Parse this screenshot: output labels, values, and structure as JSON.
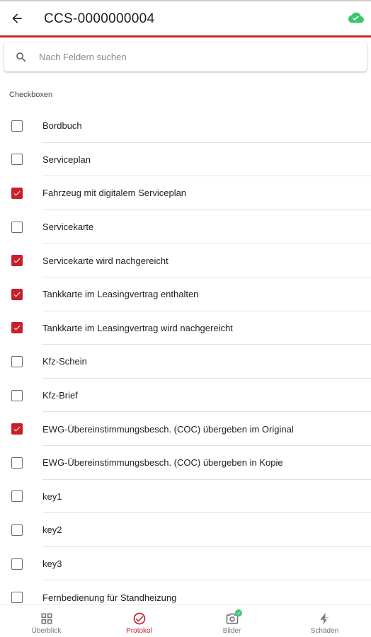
{
  "header": {
    "title": "CCS-0000000004",
    "back_icon": "arrow-left-icon",
    "sync_icon": "cloud-check-icon",
    "sync_color": "#3cc66a"
  },
  "accent_color": "#d2232a",
  "search": {
    "placeholder": "Nach Feldern suchen",
    "value": ""
  },
  "section": {
    "label": "Checkboxen"
  },
  "checkboxes": [
    {
      "label": "Bordbuch",
      "checked": false
    },
    {
      "label": "Serviceplan",
      "checked": false
    },
    {
      "label": "Fahrzeug mit digitalem Serviceplan",
      "checked": true
    },
    {
      "label": "Servicekarte",
      "checked": false
    },
    {
      "label": "Servicekarte wird nachgereicht",
      "checked": true
    },
    {
      "label": "Tankkarte im Leasingvertrag enthalten",
      "checked": true
    },
    {
      "label": "Tankkarte im Leasingvertrag wird nachgereicht",
      "checked": true
    },
    {
      "label": "Kfz-Schein",
      "checked": false
    },
    {
      "label": "Kfz-Brief",
      "checked": false
    },
    {
      "label": "EWG-Übereinstimmungsbesch. (COC) übergeben im Original",
      "checked": true
    },
    {
      "label": "EWG-Übereinstimmungsbesch. (COC) übergeben in Kopie",
      "checked": false
    },
    {
      "label": "key1",
      "checked": false
    },
    {
      "label": "key2",
      "checked": false
    },
    {
      "label": "key3",
      "checked": false
    },
    {
      "label": "Fernbedienung für Standheizung",
      "checked": false
    }
  ],
  "bottom_nav": [
    {
      "label": "Überblick",
      "icon": "grid-icon",
      "active": false
    },
    {
      "label": "Protokol",
      "icon": "check-circle-icon",
      "active": true
    },
    {
      "label": "Bilder",
      "icon": "camera-icon",
      "active": false,
      "badge": true
    },
    {
      "label": "Schäden",
      "icon": "lightning-icon",
      "active": false
    }
  ]
}
